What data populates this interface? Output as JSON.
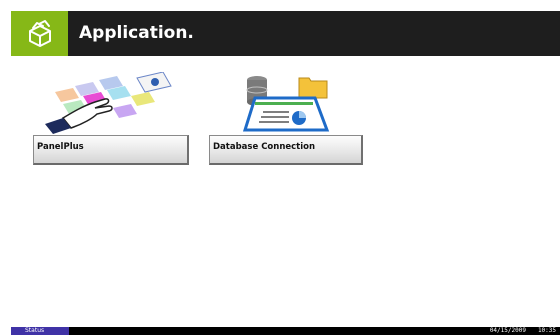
{
  "header": {
    "title": "Application.",
    "icon": "application-box-icon",
    "accent_color": "#86b817",
    "bar_color": "#1e1e1e"
  },
  "apps": [
    {
      "label": "PanelPlus",
      "icon": "panelplus-hand-tiles-icon"
    },
    {
      "label": "Database Connection",
      "icon": "database-connection-icon"
    }
  ],
  "status_bar": {
    "tab_label": "Status",
    "date": "04/15/2009",
    "time": "10:35",
    "tab_color": "#3f32a6"
  }
}
